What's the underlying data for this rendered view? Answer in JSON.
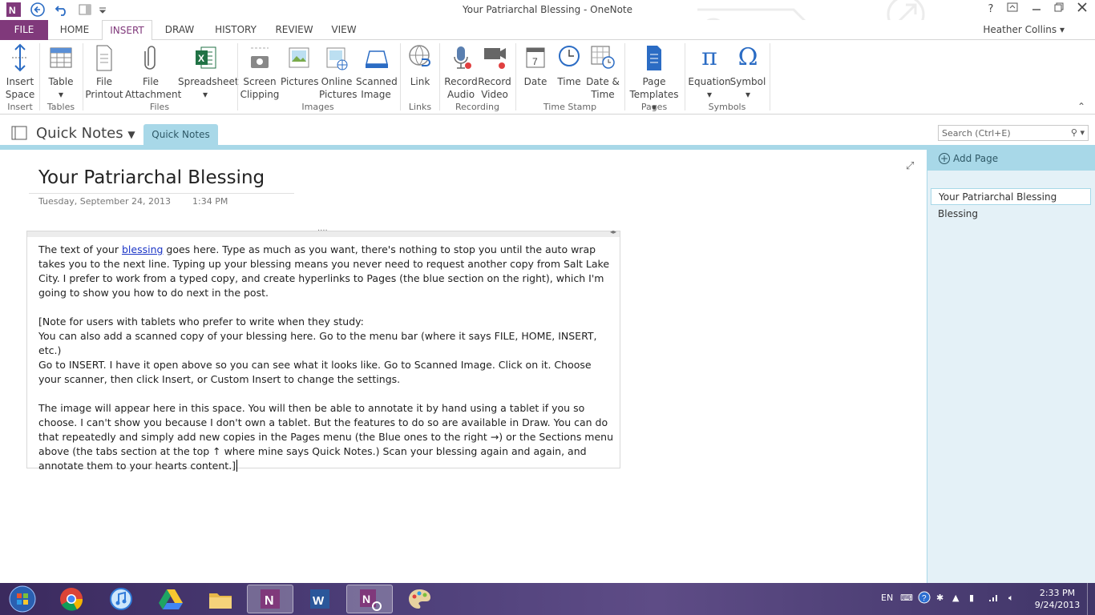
{
  "window": {
    "title": "Your Patriarchal Blessing - OneNote",
    "help": "?",
    "user_name": "Heather Collins"
  },
  "tabs": [
    "FILE",
    "HOME",
    "INSERT",
    "DRAW",
    "HISTORY",
    "REVIEW",
    "VIEW"
  ],
  "ribbon": {
    "buttons": {
      "insert_space": [
        "Insert",
        "Space"
      ],
      "table": [
        "Table",
        ""
      ],
      "file_printout": [
        "File",
        "Printout"
      ],
      "file_attachment": [
        "File",
        "Attachment"
      ],
      "spreadsheet": [
        "Spreadsheet",
        ""
      ],
      "screen_clipping": [
        "Screen",
        "Clipping"
      ],
      "pictures": [
        "Pictures",
        ""
      ],
      "online_pictures": [
        "Online",
        "Pictures"
      ],
      "scanned_image": [
        "Scanned",
        "Image"
      ],
      "link": [
        "Link",
        ""
      ],
      "record_audio": [
        "Record",
        "Audio"
      ],
      "record_video": [
        "Record",
        "Video"
      ],
      "date": [
        "Date",
        ""
      ],
      "time": [
        "Time",
        ""
      ],
      "date_time": [
        "Date &",
        "Time"
      ],
      "page_templates": [
        "Page",
        "Templates"
      ],
      "equation": [
        "Equation",
        ""
      ],
      "symbol": [
        "Symbol",
        ""
      ]
    },
    "groups": {
      "insert": "Insert",
      "tables": "Tables",
      "files": "Files",
      "images": "Images",
      "links": "Links",
      "recording": "Recording",
      "time_stamp": "Time Stamp",
      "pages": "Pages",
      "symbols": "Symbols"
    }
  },
  "notebook": {
    "name": "Quick Notes",
    "section_tab": "Quick Notes"
  },
  "search": {
    "placeholder": "Search (Ctrl+E)"
  },
  "page": {
    "title": "Your Patriarchal Blessing",
    "date": "Tuesday, September 24, 2013",
    "time": "1:34 PM",
    "note": {
      "p1_before": "The text of your ",
      "p1_link": "blessing",
      "p1_after": " goes here. Type as much as you want, there's nothing to stop you until the auto wrap takes you to the next line. Typing up your blessing means you never need to request another copy from Salt Lake City. I prefer to work from a typed copy, and create hyperlinks to Pages (the blue section on the right), which I'm going to show you how to do next in the post.",
      "p2_l1": "[Note for users with tablets who prefer to write when they study:",
      "p2_l2": "You can also add a scanned copy of your blessing here. Go to the menu bar (where it says FILE, HOME, INSERT, etc.)",
      "p2_l3": "Go to INSERT. I have it open above so you can see what it looks like. Go to Scanned Image. Click on it. Choose your scanner, then click Insert, or Custom Insert to change the settings.",
      "p3": "The image will appear here in this space. You will then be able to annotate it by hand using a tablet if you so choose. I can't show you because I don't own a tablet. But the features to do so are available in Draw.  You can do that repeatedly and simply add new copies in the Pages menu (the Blue ones to the right →) or the Sections menu above (the tabs section at the top ↑ where mine says Quick Notes.) Scan your blessing again and again, and annotate them to your hearts content.]"
    }
  },
  "pages_panel": {
    "add_page": "Add Page",
    "pages": [
      "Your Patriarchal Blessing",
      "Blessing"
    ]
  },
  "taskbar": {
    "lang": "EN",
    "time": "2:33 PM",
    "date": "9/24/2013"
  },
  "colors": {
    "onenote_purple": "#80397b",
    "section_blue": "#a8d8e8",
    "link_blue": "#1a34c6"
  }
}
